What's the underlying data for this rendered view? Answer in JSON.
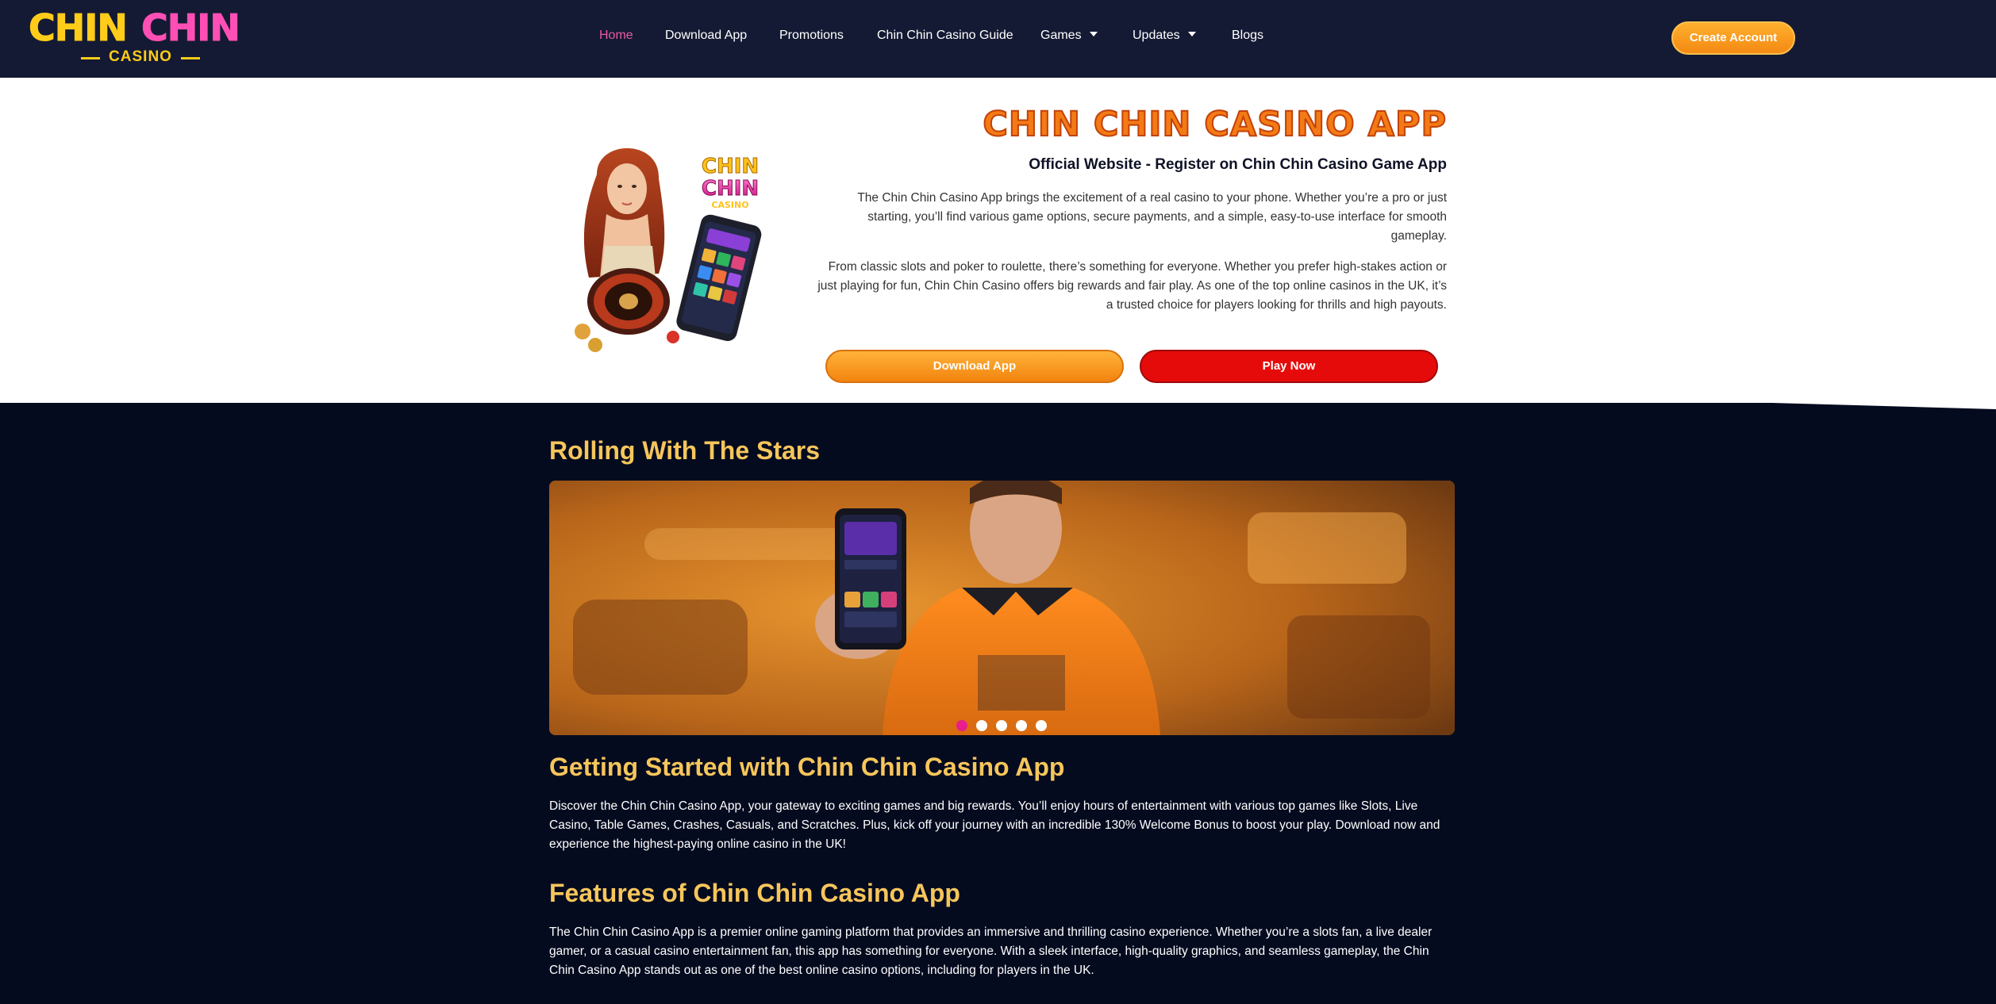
{
  "nav": {
    "logo": {
      "word1": "CHIN",
      "word2": "CHIN",
      "sub": "CASINO"
    },
    "items": [
      {
        "label": "Home",
        "active": true
      },
      {
        "label": "Download App"
      },
      {
        "label": "Promotions"
      },
      {
        "label": "Chin Chin Casino Guide"
      },
      {
        "label": "Games",
        "dropdown": true
      },
      {
        "label": "Updates",
        "dropdown": true
      },
      {
        "label": "Blogs"
      }
    ],
    "create_account": "Create Account"
  },
  "hero": {
    "illustration_logo": "CHIN CHIN CASINO",
    "title": "CHIN CHIN CASINO APP",
    "subtitle": "Official Website - Register on Chin Chin Casino Game App",
    "paragraph1": "The Chin Chin Casino App brings the excitement of a real casino to your phone. Whether you’re a pro or just starting, you’ll find various game options, secure payments, and a simple, easy-to-use interface for smooth gameplay.",
    "paragraph2": "From classic slots and poker to roulette, there’s something for everyone. Whether you prefer high-stakes action or just playing for fun, Chin Chin Casino offers big rewards and fair play. As one of the top online casinos in the UK, it’s a trusted choice for players looking for thrills and high payouts.",
    "download_button": "Download App",
    "play_button": "Play Now"
  },
  "stars": {
    "heading": "Rolling With The Stars",
    "carousel": {
      "slides": 5,
      "active": 0
    }
  },
  "getting_started": {
    "heading": "Getting Started with Chin Chin Casino App",
    "text": "Discover the Chin Chin Casino App, your gateway to exciting games and big rewards. You’ll enjoy hours of entertainment with various top games like Slots, Live Casino, Table Games, Crashes, Casuals, and Scratches. Plus, kick off your journey with an incredible 130% Welcome Bonus to boost your play. Download now and experience the highest-paying online casino in the UK!"
  },
  "features": {
    "heading": "Features of Chin Chin Casino App",
    "text": "The Chin Chin Casino App is a premier online gaming platform that provides an immersive and thrilling casino experience. Whether you’re a slots fan, a live dealer gamer, or a casual casino entertainment fan, this app has something for everyone. With a sleek interface, high-quality graphics, and seamless gameplay, the Chin Chin Casino App stands out as one of the best online casino options, including for players in the UK."
  },
  "colors": {
    "nav_bg": "#141a33",
    "page_bg": "#050b1f",
    "accent_orange": "#f47a15",
    "accent_pink": "#e95aa3",
    "heading_gold": "#f6c65b",
    "play_red": "#e60b0b"
  }
}
